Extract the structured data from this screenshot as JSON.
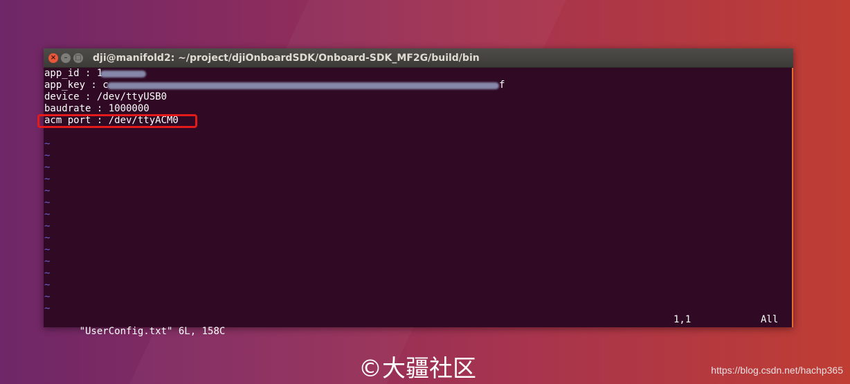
{
  "window": {
    "title": "dji@manifold2: ~/project/djiOnboardSDK/Onboard-SDK_MF2G/build/bin",
    "close_glyph": "×",
    "min_glyph": "–",
    "max_glyph": "□"
  },
  "file_lines": [
    "app_id : 1",
    "app_key : c",
    "device : /dev/ttyUSB0",
    "baudrate : 1000000",
    "acm port : /dev/ttyACM0"
  ],
  "app_key_tail": "f",
  "tilde": "~",
  "statusline": {
    "file_info": "\"UserConfig.txt\" 6L, 158C",
    "cursor_pos": "1,1",
    "scroll_pos": "All"
  },
  "watermark": "©大疆社区",
  "source_url": "https://blog.csdn.net/hachp365",
  "colors": {
    "terminal_bg": "#300a24",
    "tilde": "#6f5ccf",
    "highlight_box": "#e41a1a",
    "scroll_edge": "#e66d2e"
  }
}
